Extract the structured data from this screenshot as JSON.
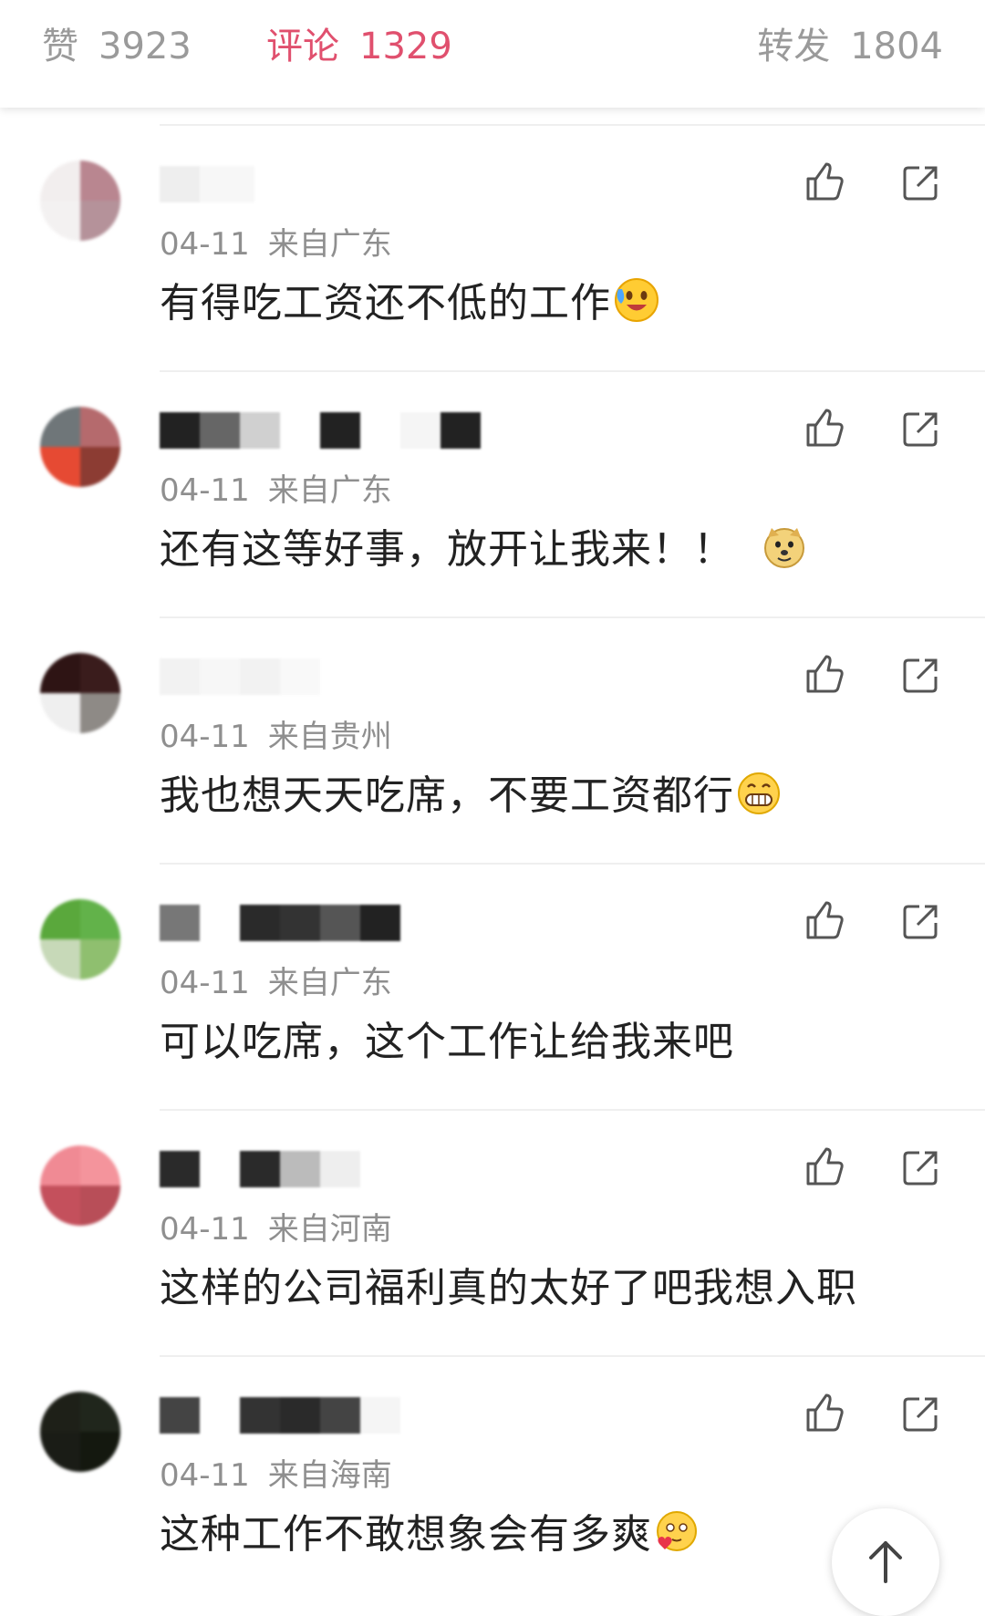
{
  "tabs": [
    {
      "label": "赞",
      "count": "3923"
    },
    {
      "label": "评论",
      "count": "1329",
      "active": true
    },
    {
      "label": "转发",
      "count": "1804"
    }
  ],
  "accent_color": "#e0506e",
  "comments": [
    {
      "date": "04-11",
      "location": "来自广东",
      "text": "有得吃工资还不低的工作",
      "emoji": "crying-laughing-emoji"
    },
    {
      "date": "04-11",
      "location": "来自广东",
      "text": "还有这等好事，放开让我来！！",
      "emoji": "doge-emoji"
    },
    {
      "date": "04-11",
      "location": "来自贵州",
      "text": "我也想天天吃席，不要工资都行",
      "emoji": "grinning-emoji"
    },
    {
      "date": "04-11",
      "location": "来自广东",
      "text": "可以吃席，这个工作让给我来吧",
      "emoji": ""
    },
    {
      "date": "04-11",
      "location": "来自河南",
      "text": "这样的公司福利真的太好了吧我想入职",
      "emoji": ""
    },
    {
      "date": "04-11",
      "location": "来自海南",
      "text": "这种工作不敢想象会有多爽",
      "emoji": "heart-eyes-emoji"
    }
  ],
  "icons": {
    "like": "thumbs-up-icon",
    "share": "share-icon",
    "scroll_top": "arrow-up-icon"
  }
}
